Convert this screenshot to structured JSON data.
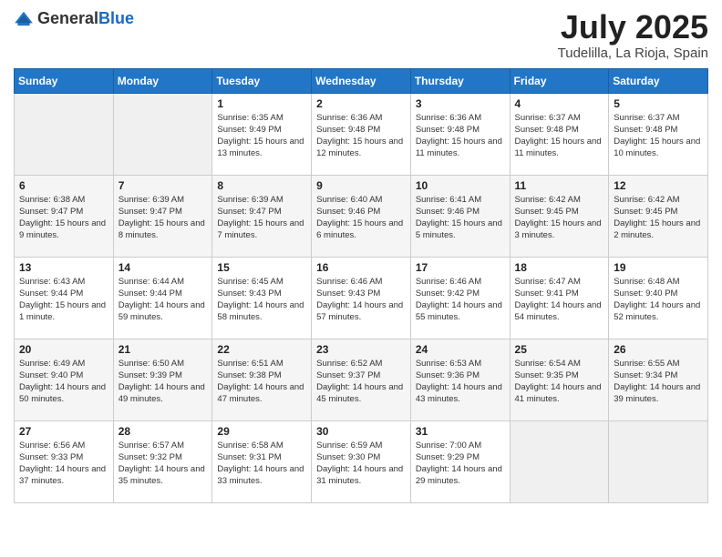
{
  "logo": {
    "general": "General",
    "blue": "Blue"
  },
  "title": "July 2025",
  "location": "Tudelilla, La Rioja, Spain",
  "weekdays": [
    "Sunday",
    "Monday",
    "Tuesday",
    "Wednesday",
    "Thursday",
    "Friday",
    "Saturday"
  ],
  "weeks": [
    [
      {
        "day": "",
        "sunrise": "",
        "sunset": "",
        "daylight": ""
      },
      {
        "day": "",
        "sunrise": "",
        "sunset": "",
        "daylight": ""
      },
      {
        "day": "1",
        "sunrise": "Sunrise: 6:35 AM",
        "sunset": "Sunset: 9:49 PM",
        "daylight": "Daylight: 15 hours and 13 minutes."
      },
      {
        "day": "2",
        "sunrise": "Sunrise: 6:36 AM",
        "sunset": "Sunset: 9:48 PM",
        "daylight": "Daylight: 15 hours and 12 minutes."
      },
      {
        "day": "3",
        "sunrise": "Sunrise: 6:36 AM",
        "sunset": "Sunset: 9:48 PM",
        "daylight": "Daylight: 15 hours and 11 minutes."
      },
      {
        "day": "4",
        "sunrise": "Sunrise: 6:37 AM",
        "sunset": "Sunset: 9:48 PM",
        "daylight": "Daylight: 15 hours and 11 minutes."
      },
      {
        "day": "5",
        "sunrise": "Sunrise: 6:37 AM",
        "sunset": "Sunset: 9:48 PM",
        "daylight": "Daylight: 15 hours and 10 minutes."
      }
    ],
    [
      {
        "day": "6",
        "sunrise": "Sunrise: 6:38 AM",
        "sunset": "Sunset: 9:47 PM",
        "daylight": "Daylight: 15 hours and 9 minutes."
      },
      {
        "day": "7",
        "sunrise": "Sunrise: 6:39 AM",
        "sunset": "Sunset: 9:47 PM",
        "daylight": "Daylight: 15 hours and 8 minutes."
      },
      {
        "day": "8",
        "sunrise": "Sunrise: 6:39 AM",
        "sunset": "Sunset: 9:47 PM",
        "daylight": "Daylight: 15 hours and 7 minutes."
      },
      {
        "day": "9",
        "sunrise": "Sunrise: 6:40 AM",
        "sunset": "Sunset: 9:46 PM",
        "daylight": "Daylight: 15 hours and 6 minutes."
      },
      {
        "day": "10",
        "sunrise": "Sunrise: 6:41 AM",
        "sunset": "Sunset: 9:46 PM",
        "daylight": "Daylight: 15 hours and 5 minutes."
      },
      {
        "day": "11",
        "sunrise": "Sunrise: 6:42 AM",
        "sunset": "Sunset: 9:45 PM",
        "daylight": "Daylight: 15 hours and 3 minutes."
      },
      {
        "day": "12",
        "sunrise": "Sunrise: 6:42 AM",
        "sunset": "Sunset: 9:45 PM",
        "daylight": "Daylight: 15 hours and 2 minutes."
      }
    ],
    [
      {
        "day": "13",
        "sunrise": "Sunrise: 6:43 AM",
        "sunset": "Sunset: 9:44 PM",
        "daylight": "Daylight: 15 hours and 1 minute."
      },
      {
        "day": "14",
        "sunrise": "Sunrise: 6:44 AM",
        "sunset": "Sunset: 9:44 PM",
        "daylight": "Daylight: 14 hours and 59 minutes."
      },
      {
        "day": "15",
        "sunrise": "Sunrise: 6:45 AM",
        "sunset": "Sunset: 9:43 PM",
        "daylight": "Daylight: 14 hours and 58 minutes."
      },
      {
        "day": "16",
        "sunrise": "Sunrise: 6:46 AM",
        "sunset": "Sunset: 9:43 PM",
        "daylight": "Daylight: 14 hours and 57 minutes."
      },
      {
        "day": "17",
        "sunrise": "Sunrise: 6:46 AM",
        "sunset": "Sunset: 9:42 PM",
        "daylight": "Daylight: 14 hours and 55 minutes."
      },
      {
        "day": "18",
        "sunrise": "Sunrise: 6:47 AM",
        "sunset": "Sunset: 9:41 PM",
        "daylight": "Daylight: 14 hours and 54 minutes."
      },
      {
        "day": "19",
        "sunrise": "Sunrise: 6:48 AM",
        "sunset": "Sunset: 9:40 PM",
        "daylight": "Daylight: 14 hours and 52 minutes."
      }
    ],
    [
      {
        "day": "20",
        "sunrise": "Sunrise: 6:49 AM",
        "sunset": "Sunset: 9:40 PM",
        "daylight": "Daylight: 14 hours and 50 minutes."
      },
      {
        "day": "21",
        "sunrise": "Sunrise: 6:50 AM",
        "sunset": "Sunset: 9:39 PM",
        "daylight": "Daylight: 14 hours and 49 minutes."
      },
      {
        "day": "22",
        "sunrise": "Sunrise: 6:51 AM",
        "sunset": "Sunset: 9:38 PM",
        "daylight": "Daylight: 14 hours and 47 minutes."
      },
      {
        "day": "23",
        "sunrise": "Sunrise: 6:52 AM",
        "sunset": "Sunset: 9:37 PM",
        "daylight": "Daylight: 14 hours and 45 minutes."
      },
      {
        "day": "24",
        "sunrise": "Sunrise: 6:53 AM",
        "sunset": "Sunset: 9:36 PM",
        "daylight": "Daylight: 14 hours and 43 minutes."
      },
      {
        "day": "25",
        "sunrise": "Sunrise: 6:54 AM",
        "sunset": "Sunset: 9:35 PM",
        "daylight": "Daylight: 14 hours and 41 minutes."
      },
      {
        "day": "26",
        "sunrise": "Sunrise: 6:55 AM",
        "sunset": "Sunset: 9:34 PM",
        "daylight": "Daylight: 14 hours and 39 minutes."
      }
    ],
    [
      {
        "day": "27",
        "sunrise": "Sunrise: 6:56 AM",
        "sunset": "Sunset: 9:33 PM",
        "daylight": "Daylight: 14 hours and 37 minutes."
      },
      {
        "day": "28",
        "sunrise": "Sunrise: 6:57 AM",
        "sunset": "Sunset: 9:32 PM",
        "daylight": "Daylight: 14 hours and 35 minutes."
      },
      {
        "day": "29",
        "sunrise": "Sunrise: 6:58 AM",
        "sunset": "Sunset: 9:31 PM",
        "daylight": "Daylight: 14 hours and 33 minutes."
      },
      {
        "day": "30",
        "sunrise": "Sunrise: 6:59 AM",
        "sunset": "Sunset: 9:30 PM",
        "daylight": "Daylight: 14 hours and 31 minutes."
      },
      {
        "day": "31",
        "sunrise": "Sunrise: 7:00 AM",
        "sunset": "Sunset: 9:29 PM",
        "daylight": "Daylight: 14 hours and 29 minutes."
      },
      {
        "day": "",
        "sunrise": "",
        "sunset": "",
        "daylight": ""
      },
      {
        "day": "",
        "sunrise": "",
        "sunset": "",
        "daylight": ""
      }
    ]
  ]
}
